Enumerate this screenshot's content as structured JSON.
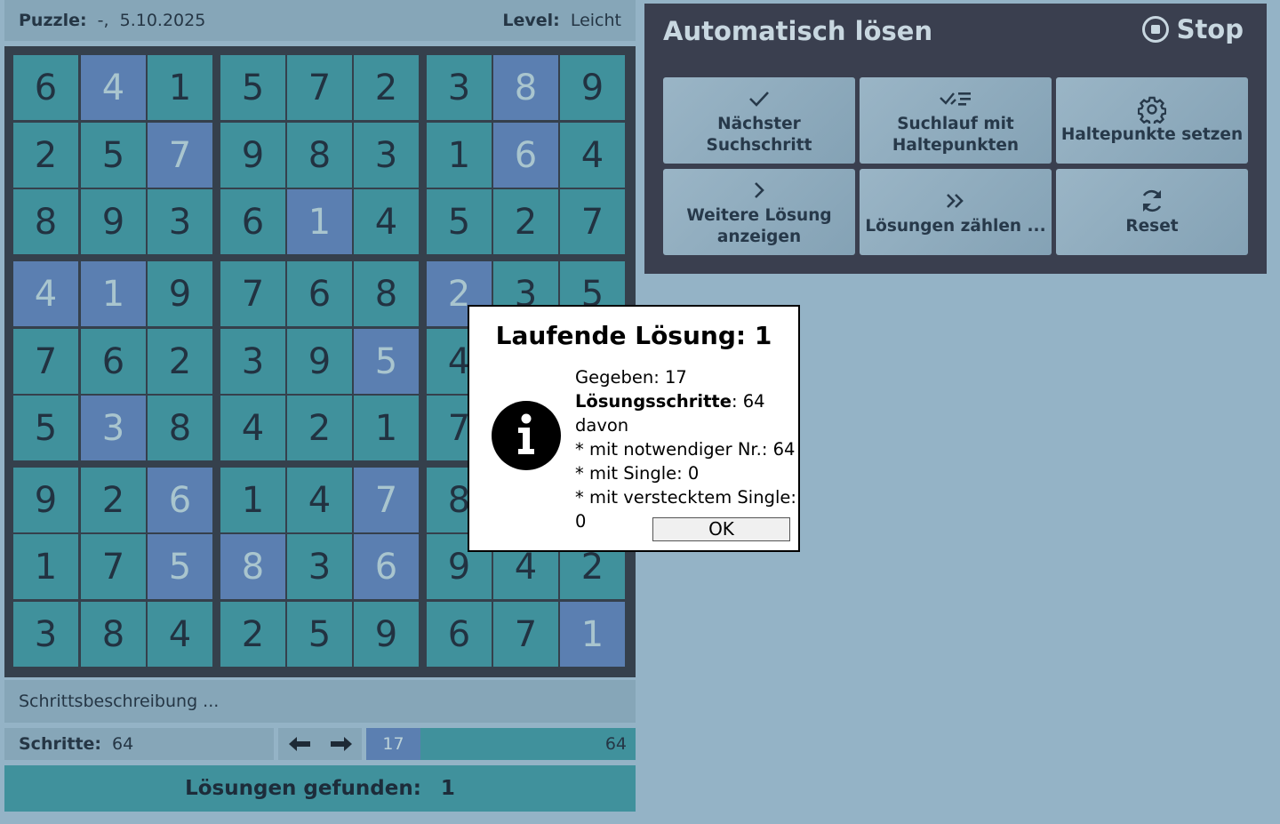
{
  "header": {
    "puzzle_label": "Puzzle:",
    "puzzle_value": "-,  5.10.2025",
    "level_label": "Level:",
    "level_value": "Leicht"
  },
  "grid": [
    [
      {
        "v": "6",
        "g": false
      },
      {
        "v": "4",
        "g": true
      },
      {
        "v": "1",
        "g": false
      },
      {
        "v": "5",
        "g": false
      },
      {
        "v": "7",
        "g": false
      },
      {
        "v": "2",
        "g": false
      },
      {
        "v": "3",
        "g": false
      },
      {
        "v": "8",
        "g": true
      },
      {
        "v": "9",
        "g": false
      }
    ],
    [
      {
        "v": "2",
        "g": false
      },
      {
        "v": "5",
        "g": false
      },
      {
        "v": "7",
        "g": true
      },
      {
        "v": "9",
        "g": false
      },
      {
        "v": "8",
        "g": false
      },
      {
        "v": "3",
        "g": false
      },
      {
        "v": "1",
        "g": false
      },
      {
        "v": "6",
        "g": true
      },
      {
        "v": "4",
        "g": false
      }
    ],
    [
      {
        "v": "8",
        "g": false
      },
      {
        "v": "9",
        "g": false
      },
      {
        "v": "3",
        "g": false
      },
      {
        "v": "6",
        "g": false
      },
      {
        "v": "1",
        "g": true
      },
      {
        "v": "4",
        "g": false
      },
      {
        "v": "5",
        "g": false
      },
      {
        "v": "2",
        "g": false
      },
      {
        "v": "7",
        "g": false
      }
    ],
    [
      {
        "v": "4",
        "g": true
      },
      {
        "v": "1",
        "g": true
      },
      {
        "v": "9",
        "g": false
      },
      {
        "v": "7",
        "g": false
      },
      {
        "v": "6",
        "g": false
      },
      {
        "v": "8",
        "g": false
      },
      {
        "v": "2",
        "g": true
      },
      {
        "v": "3",
        "g": false
      },
      {
        "v": "5",
        "g": false
      }
    ],
    [
      {
        "v": "7",
        "g": false
      },
      {
        "v": "6",
        "g": false
      },
      {
        "v": "2",
        "g": false
      },
      {
        "v": "3",
        "g": false
      },
      {
        "v": "9",
        "g": false
      },
      {
        "v": "5",
        "g": true
      },
      {
        "v": "4",
        "g": false
      },
      {
        "v": "",
        "g": false
      },
      {
        "v": "",
        "g": false
      }
    ],
    [
      {
        "v": "5",
        "g": false
      },
      {
        "v": "3",
        "g": true
      },
      {
        "v": "8",
        "g": false
      },
      {
        "v": "4",
        "g": false
      },
      {
        "v": "2",
        "g": false
      },
      {
        "v": "1",
        "g": false
      },
      {
        "v": "7",
        "g": false
      },
      {
        "v": "",
        "g": false
      },
      {
        "v": "",
        "g": false
      }
    ],
    [
      {
        "v": "9",
        "g": false
      },
      {
        "v": "2",
        "g": false
      },
      {
        "v": "6",
        "g": true
      },
      {
        "v": "1",
        "g": false
      },
      {
        "v": "4",
        "g": false
      },
      {
        "v": "7",
        "g": true
      },
      {
        "v": "8",
        "g": false
      },
      {
        "v": "",
        "g": false
      },
      {
        "v": "",
        "g": false
      }
    ],
    [
      {
        "v": "1",
        "g": false
      },
      {
        "v": "7",
        "g": false
      },
      {
        "v": "5",
        "g": true
      },
      {
        "v": "8",
        "g": true
      },
      {
        "v": "3",
        "g": false
      },
      {
        "v": "6",
        "g": true
      },
      {
        "v": "9",
        "g": false
      },
      {
        "v": "4",
        "g": false
      },
      {
        "v": "2",
        "g": false
      }
    ],
    [
      {
        "v": "3",
        "g": false
      },
      {
        "v": "8",
        "g": false
      },
      {
        "v": "4",
        "g": false
      },
      {
        "v": "2",
        "g": false
      },
      {
        "v": "5",
        "g": false
      },
      {
        "v": "9",
        "g": false
      },
      {
        "v": "6",
        "g": false
      },
      {
        "v": "7",
        "g": false
      },
      {
        "v": "1",
        "g": true
      }
    ]
  ],
  "description": "Schrittsbeschreibung ...",
  "steps": {
    "label": "Schritte:",
    "value": "64",
    "progress_current": "17",
    "progress_max": "64",
    "progress_fraction": 0.2
  },
  "found": {
    "label": "Lösungen gefunden:",
    "value": "1"
  },
  "panel": {
    "title": "Automatisch lösen",
    "stop_label": "Stop",
    "buttons": [
      {
        "label": "Nächster Suchschritt",
        "icon": "check-icon"
      },
      {
        "label": "Suchlauf mit Haltepunkten",
        "icon": "checklist-icon"
      },
      {
        "label": "Haltepunkte setzen",
        "icon": "gear-icon"
      },
      {
        "label": "Weitere Lösung anzeigen",
        "icon": "chevron-right-icon"
      },
      {
        "label": "Lösungen zählen ...",
        "icon": "double-chevron-right-icon"
      },
      {
        "label": "Reset",
        "icon": "refresh-icon"
      }
    ]
  },
  "dialog": {
    "title": "Laufende Lösung: 1",
    "line1": "Gegeben: 17",
    "line2_bold": "Lösungsschritte",
    "line2_rest": ": 64",
    "line3": "davon",
    "line4": "* mit notwendiger Nr.: 64",
    "line5": "* mit Single: 0",
    "line6": "* mit verstecktem Single: 0",
    "ok_label": "OK"
  },
  "colors": {
    "background": "#94b3c6",
    "cell": "#40919c",
    "given_cell": "#5b7fb1",
    "panel": "#3a3f4f"
  }
}
